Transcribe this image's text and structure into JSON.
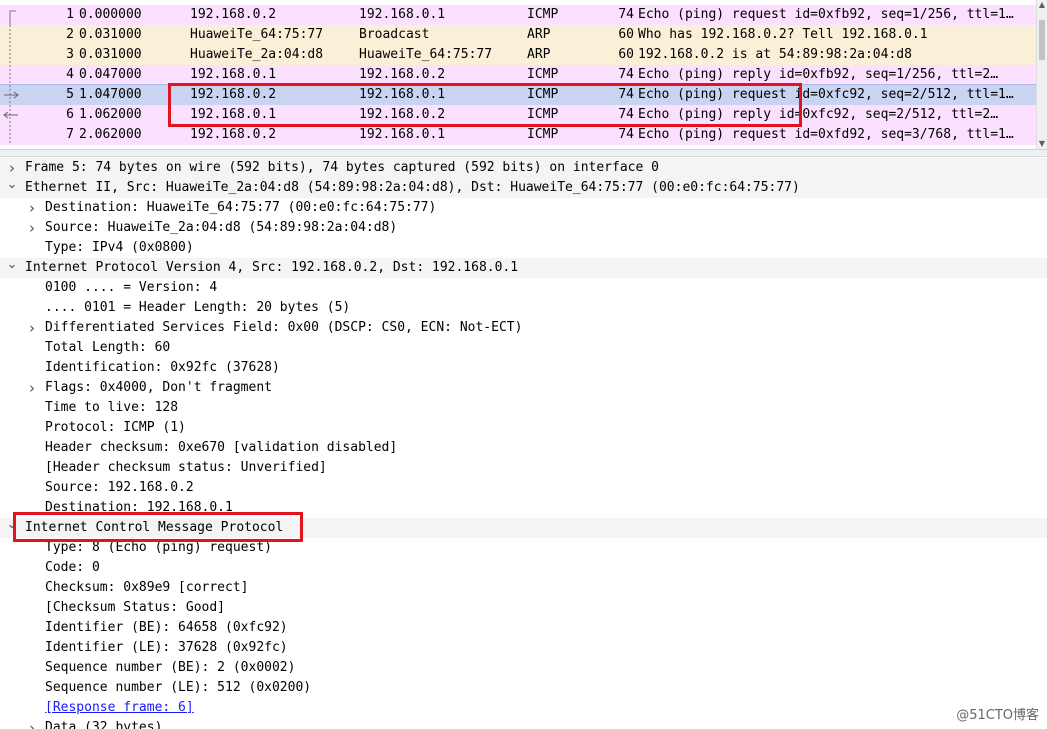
{
  "packets": [
    {
      "no": "1",
      "time": "0.000000",
      "source": "192.168.0.2",
      "destination": "192.168.0.1",
      "protocol": "ICMP",
      "length": "74",
      "info": "Echo (ping) request  id=0xfb92, seq=1/256, ttl=1…",
      "bg": "#fce0ff"
    },
    {
      "no": "2",
      "time": "0.031000",
      "source": "HuaweiTe_64:75:77",
      "destination": "Broadcast",
      "protocol": "ARP",
      "length": "60",
      "info": "Who has 192.168.0.2? Tell 192.168.0.1",
      "bg": "#faf0d7"
    },
    {
      "no": "3",
      "time": "0.031000",
      "source": "HuaweiTe_2a:04:d8",
      "destination": "HuaweiTe_64:75:77",
      "protocol": "ARP",
      "length": "60",
      "info": "192.168.0.2 is at 54:89:98:2a:04:d8",
      "bg": "#faf0d7"
    },
    {
      "no": "4",
      "time": "0.047000",
      "source": "192.168.0.1",
      "destination": "192.168.0.2",
      "protocol": "ICMP",
      "length": "74",
      "info": "Echo (ping) reply    id=0xfb92, seq=1/256, ttl=2…",
      "bg": "#fce0ff"
    },
    {
      "no": "5",
      "time": "1.047000",
      "source": "192.168.0.2",
      "destination": "192.168.0.1",
      "protocol": "ICMP",
      "length": "74",
      "info": "Echo (ping) request  id=0xfc92, seq=2/512, ttl=1…",
      "bg": "#c9d4f2",
      "selected": true
    },
    {
      "no": "6",
      "time": "1.062000",
      "source": "192.168.0.1",
      "destination": "192.168.0.2",
      "protocol": "ICMP",
      "length": "74",
      "info": "Echo (ping) reply    id=0xfc92, seq=2/512, ttl=2…",
      "bg": "#fce0ff"
    },
    {
      "no": "7",
      "time": "2.062000",
      "source": "192.168.0.2",
      "destination": "192.168.0.1",
      "protocol": "ICMP",
      "length": "74",
      "info": "Echo (ping) request  id=0xfd92, seq=3/768, ttl=1…",
      "bg": "#fce0ff"
    }
  ],
  "details": [
    {
      "text": "Frame 5: 74 bytes on wire (592 bits), 74 bytes captured (592 bits) on interface 0",
      "level": 0,
      "toggle": "collapsed"
    },
    {
      "text": "Ethernet II, Src: HuaweiTe_2a:04:d8 (54:89:98:2a:04:d8), Dst: HuaweiTe_64:75:77 (00:e0:fc:64:75:77)",
      "level": 0,
      "toggle": "expanded"
    },
    {
      "text": "Destination: HuaweiTe_64:75:77 (00:e0:fc:64:75:77)",
      "level": 1,
      "toggle": "collapsed"
    },
    {
      "text": "Source: HuaweiTe_2a:04:d8 (54:89:98:2a:04:d8)",
      "level": 1,
      "toggle": "collapsed"
    },
    {
      "text": "Type: IPv4 (0x0800)",
      "level": 1,
      "toggle": "none"
    },
    {
      "text": "Internet Protocol Version 4, Src: 192.168.0.2, Dst: 192.168.0.1",
      "level": 0,
      "toggle": "expanded"
    },
    {
      "text": "0100 .... = Version: 4",
      "level": 1,
      "toggle": "none"
    },
    {
      "text": ".... 0101 = Header Length: 20 bytes (5)",
      "level": 1,
      "toggle": "none"
    },
    {
      "text": "Differentiated Services Field: 0x00 (DSCP: CS0, ECN: Not-ECT)",
      "level": 1,
      "toggle": "collapsed"
    },
    {
      "text": "Total Length: 60",
      "level": 1,
      "toggle": "none"
    },
    {
      "text": "Identification: 0x92fc (37628)",
      "level": 1,
      "toggle": "none"
    },
    {
      "text": "Flags: 0x4000, Don't fragment",
      "level": 1,
      "toggle": "collapsed"
    },
    {
      "text": "Time to live: 128",
      "level": 1,
      "toggle": "none"
    },
    {
      "text": "Protocol: ICMP (1)",
      "level": 1,
      "toggle": "none"
    },
    {
      "text": "Header checksum: 0xe670 [validation disabled]",
      "level": 1,
      "toggle": "none"
    },
    {
      "text": "[Header checksum status: Unverified]",
      "level": 1,
      "toggle": "none"
    },
    {
      "text": "Source: 192.168.0.2",
      "level": 1,
      "toggle": "none"
    },
    {
      "text": "Destination: 192.168.0.1",
      "level": 1,
      "toggle": "none"
    },
    {
      "text": "Internet Control Message Protocol",
      "level": 0,
      "toggle": "expanded"
    },
    {
      "text": "Type: 8 (Echo (ping) request)",
      "level": 1,
      "toggle": "none"
    },
    {
      "text": "Code: 0",
      "level": 1,
      "toggle": "none"
    },
    {
      "text": "Checksum: 0x89e9 [correct]",
      "level": 1,
      "toggle": "none"
    },
    {
      "text": "[Checksum Status: Good]",
      "level": 1,
      "toggle": "none"
    },
    {
      "text": "Identifier (BE): 64658 (0xfc92)",
      "level": 1,
      "toggle": "none"
    },
    {
      "text": "Identifier (LE): 37628 (0x92fc)",
      "level": 1,
      "toggle": "none"
    },
    {
      "text": "Sequence number (BE): 2 (0x0002)",
      "level": 1,
      "toggle": "none"
    },
    {
      "text": "Sequence number (LE): 512 (0x0200)",
      "level": 1,
      "toggle": "none"
    },
    {
      "text": "[Response frame: 6]",
      "level": 1,
      "toggle": "none",
      "link": true
    },
    {
      "text": "Data (32 bytes)",
      "level": 1,
      "toggle": "collapsed"
    }
  ],
  "watermark": "@51CTO博客",
  "colors": {
    "icmp_row": "#fce0ff",
    "arp_row": "#faf0d7",
    "selected_row": "#c9d4f2",
    "annotation_red": "#e0141e",
    "link": "#1a1aff"
  },
  "icons": {
    "collapsed": "chevron-right-icon",
    "expanded": "chevron-down-icon"
  }
}
